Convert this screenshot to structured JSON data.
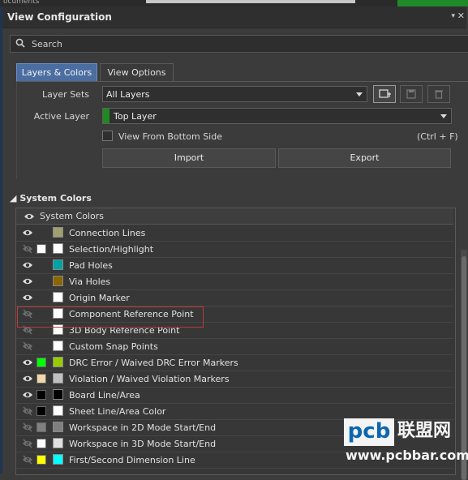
{
  "top_strip": {
    "doc_fragment": "ocuments"
  },
  "panel": {
    "title": "View Configuration",
    "dropdown_glyph": "▾",
    "close_glyph": "✕"
  },
  "search": {
    "placeholder": "Search",
    "icon": "search-icon"
  },
  "tabs": [
    {
      "label": "Layers & Colors",
      "active": true
    },
    {
      "label": "View Options",
      "active": false
    }
  ],
  "layer_sets": {
    "label": "Layer Sets",
    "value": "All Layers"
  },
  "active_layer": {
    "label": "Active Layer",
    "value": "Top Layer",
    "color": "#1f8a1f"
  },
  "view_bottom": {
    "label": "View From Bottom Side",
    "shortcut": "(Ctrl + F)",
    "checked": false
  },
  "buttons": {
    "import": "Import",
    "export": "Export"
  },
  "system_colors": {
    "section_title": "System Colors",
    "header": "System Colors",
    "rows": [
      {
        "name": "Connection Lines",
        "visible": true,
        "c1": null,
        "c2": "#a0a06e"
      },
      {
        "name": "Selection/Highlight",
        "visible": false,
        "c1": "#ffffff",
        "c2": "#ffffff"
      },
      {
        "name": "Pad Holes",
        "visible": true,
        "c1": null,
        "c2": "#00a3a3"
      },
      {
        "name": "Via Holes",
        "visible": true,
        "c1": null,
        "c2": "#8a6500"
      },
      {
        "name": "Origin Marker",
        "visible": true,
        "c1": null,
        "c2": "#ffffff"
      },
      {
        "name": "Component Reference Point",
        "visible": false,
        "c1": null,
        "c2": "#ffffff"
      },
      {
        "name": "3D Body Reference Point",
        "visible": false,
        "c1": null,
        "c2": "#ffffff"
      },
      {
        "name": "Custom Snap Points",
        "visible": false,
        "c1": null,
        "c2": "#ffffff"
      },
      {
        "name": "DRC Error / Waived DRC Error Markers",
        "visible": true,
        "c1": "#00ff00",
        "c2": "#99cc00"
      },
      {
        "name": "Violation / Waived Violation Markers",
        "visible": true,
        "c1": "#f0d8a8",
        "c2": "#c0c0c0"
      },
      {
        "name": "Board Line/Area",
        "visible": true,
        "c1": "#000000",
        "c2": "#000000"
      },
      {
        "name": "Sheet Line/Area Color",
        "visible": false,
        "c1": "#000000",
        "c2": "#ffffff"
      },
      {
        "name": "Workspace in 2D Mode Start/End",
        "visible": false,
        "c1": "#808080",
        "c2": "#808080"
      },
      {
        "name": "Workspace in 3D Mode Start/End",
        "visible": false,
        "c1": "#ffffff",
        "c2": "#e0e0e0"
      },
      {
        "name": "First/Second Dimension Line",
        "visible": false,
        "c1": "#ffff00",
        "c2": "#00ffff"
      }
    ]
  },
  "watermark": {
    "brand": "pcb",
    "cn": "联盟网",
    "url": "www.pcbbar.com"
  }
}
